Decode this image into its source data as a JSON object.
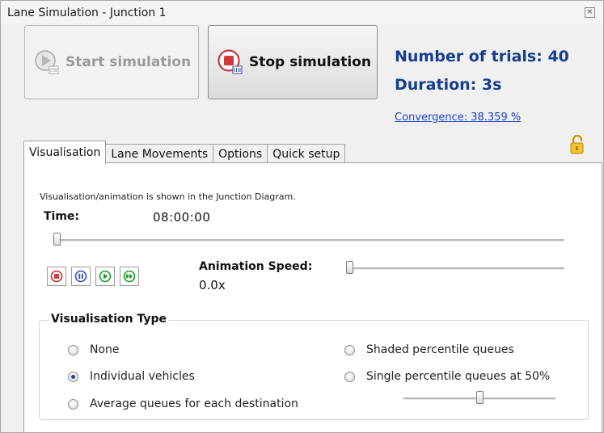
{
  "window": {
    "title": "Lane Simulation - Junction 1",
    "close_icon": "close-icon"
  },
  "toolbar": {
    "start_label": "Start simulation",
    "stop_label": "Stop simulation",
    "start_enabled": false
  },
  "stats": {
    "trials": "Number of trials: 40",
    "duration": "Duration: 3s",
    "convergence": "Convergence: 38.359 %"
  },
  "tabs": [
    {
      "label": "Visualisation",
      "active": true
    },
    {
      "label": "Lane Movements",
      "active": false
    },
    {
      "label": "Options",
      "active": false
    },
    {
      "label": "Quick setup",
      "active": false
    }
  ],
  "visualisation": {
    "notice": "Visualisation/animation is shown in the Junction Diagram.",
    "time_label": "Time:",
    "time_value": "08:00:00",
    "time_slider_fraction": 0.0,
    "playback_buttons": [
      "stop-icon",
      "pause-icon",
      "play-icon",
      "fast-forward-icon"
    ],
    "anim_speed_label": "Animation Speed:",
    "anim_speed_value": "0.0x",
    "anim_speed_fraction": 0.0,
    "type_group": {
      "title": "Visualisation Type",
      "options": [
        {
          "label": "None",
          "checked": false
        },
        {
          "label": "Individual vehicles",
          "checked": true
        },
        {
          "label": "Average queues for each destination",
          "checked": false
        },
        {
          "label": "Shaded percentile queues",
          "checked": false
        },
        {
          "label": "Single percentile queues at 50%",
          "checked": false
        }
      ],
      "percentile_slider_fraction": 0.5
    }
  },
  "colors": {
    "stats_text": "#173d8f",
    "link": "#1c44c2",
    "stop_red": "#d23a3a",
    "ctrl_blue": "#2e4fc4",
    "ctrl_green": "#1f9a28"
  }
}
